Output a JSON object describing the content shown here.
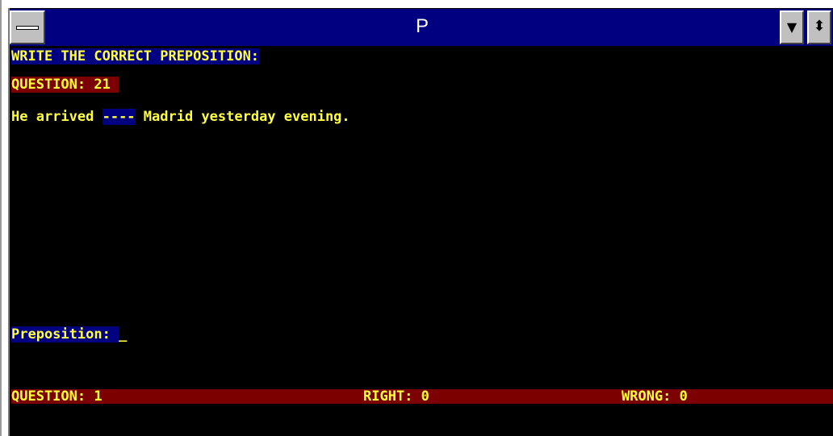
{
  "window": {
    "title": "P",
    "minimize_glyph": "▼",
    "restore_glyph": "⬍"
  },
  "screen": {
    "instruction": "WRITE THE CORRECT PREPOSITION:",
    "question_header": "QUESTION: 21 ",
    "sentence_before": "He arrived ",
    "blank": "----",
    "sentence_after": " Madrid yesterday evening.",
    "prompt_label": "Preposition: ",
    "input_value": "_"
  },
  "status": {
    "question": "QUESTION: 1",
    "right": "RIGHT: 0",
    "wrong": "WRONG: 0"
  },
  "colors": {
    "text": "#ffff3c",
    "title_bg": "#000080",
    "highlight_red": "#7c0000",
    "highlight_blue": "#000080",
    "background": "#000000"
  }
}
